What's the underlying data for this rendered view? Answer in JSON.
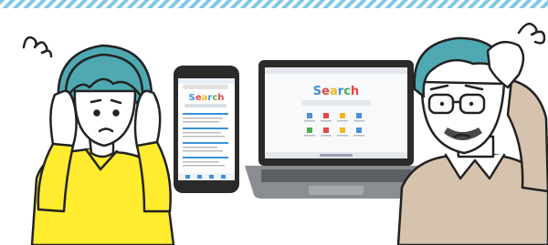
{
  "illustration": {
    "phone_screen": {
      "search_word": "Search",
      "letter_colors": [
        "#3b8fd9",
        "#e64646",
        "#f2b81d",
        "#3b8fd9",
        "#4cb04c",
        "#e64646"
      ]
    },
    "laptop_screen": {
      "search_word": "Search",
      "letter_colors": [
        "#3b8fd9",
        "#e64646",
        "#f2b81d",
        "#3b8fd9",
        "#4cb04c",
        "#e64646"
      ],
      "shortcut_colors": [
        "#4a90d9",
        "#e64646",
        "#f2b81d",
        "#4a90d9",
        "#4cb04c",
        "#e64646",
        "#f2b81d",
        "#4a90d9"
      ]
    },
    "colors": {
      "banner_stripe": "#7fc8e6",
      "hair": "#4fa9b3",
      "woman_shirt": "#ffec2e",
      "man_sweater": "#d6c3ad",
      "skin": "#ffffff",
      "outline": "#222222",
      "phone_accent": "#3b8fd9",
      "laptop_body": "#8a8d91"
    }
  }
}
